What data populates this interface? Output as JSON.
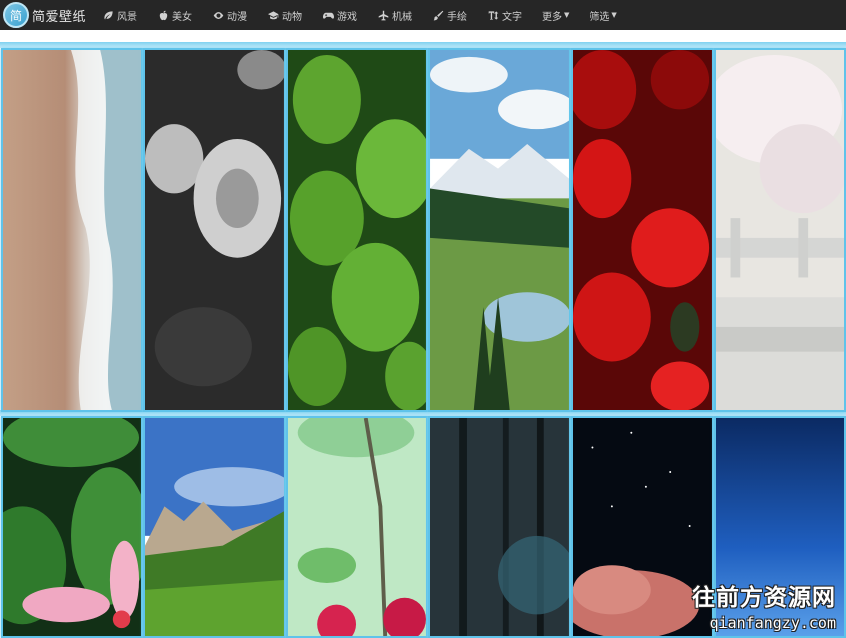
{
  "app": {
    "logo_char": "简",
    "brand": "简爱壁纸"
  },
  "nav": {
    "items": [
      {
        "label": "风景",
        "icon": "leaf-icon"
      },
      {
        "label": "美女",
        "icon": "apple-icon"
      },
      {
        "label": "动漫",
        "icon": "eye-icon"
      },
      {
        "label": "动物",
        "icon": "graduation-cap-icon"
      },
      {
        "label": "游戏",
        "icon": "gamepad-icon"
      },
      {
        "label": "机械",
        "icon": "plane-icon"
      },
      {
        "label": "手绘",
        "icon": "brush-icon"
      },
      {
        "label": "文字",
        "icon": "text-height-icon"
      }
    ],
    "more": "更多",
    "filter": "筛选"
  },
  "wallpapers": [
    {
      "subject": "beach-waves"
    },
    {
      "subject": "grayscale-flowers"
    },
    {
      "subject": "green-nettle-leaves"
    },
    {
      "subject": "mountain-lake-forest"
    },
    {
      "subject": "red-roses"
    },
    {
      "subject": "cherry-blossom-railing"
    },
    {
      "subject": "pink-flower-leaves"
    },
    {
      "subject": "alpine-valley"
    },
    {
      "subject": "red-berries-branch"
    },
    {
      "subject": "dark-forest"
    },
    {
      "subject": "night-sky-cloud"
    },
    {
      "subject": "blue-gradient-sky"
    }
  ],
  "watermark": {
    "cn": "往前方资源网",
    "en": "qianfangzy.com"
  },
  "colors": {
    "nav_bg": "#262626",
    "tile_border": "#5fc3ea"
  }
}
